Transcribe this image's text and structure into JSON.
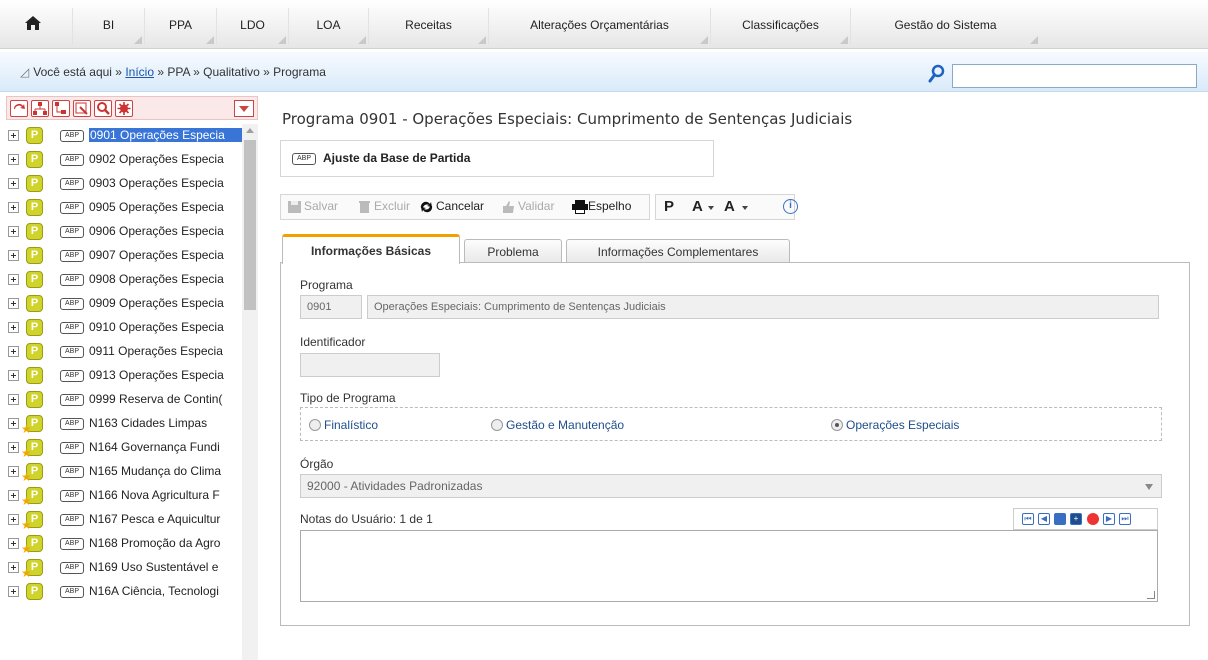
{
  "topmenu": {
    "items": [
      {
        "label": "BI"
      },
      {
        "label": "PPA"
      },
      {
        "label": "LDO"
      },
      {
        "label": "LOA"
      },
      {
        "label": "Receitas"
      },
      {
        "label": "Alterações Orçamentárias"
      },
      {
        "label": "Classificações"
      },
      {
        "label": "Gestão do Sistema"
      }
    ]
  },
  "breadcrumb": {
    "prefix": "Você está aqui » ",
    "home_link": "Início",
    "path": " » PPA » Qualitativo » Programa"
  },
  "search": {
    "value": ""
  },
  "tree": {
    "items": [
      {
        "label": "0901 Operações Especia"
      },
      {
        "label": "0902 Operações Especia"
      },
      {
        "label": "0903 Operações Especia"
      },
      {
        "label": "0905 Operações Especia"
      },
      {
        "label": "0906 Operações Especia"
      },
      {
        "label": "0907 Operações Especia"
      },
      {
        "label": "0908 Operações Especia"
      },
      {
        "label": "0909 Operações Especia"
      },
      {
        "label": "0910 Operações Especia"
      },
      {
        "label": "0911 Operações Especia"
      },
      {
        "label": "0913 Operações Especia"
      },
      {
        "label": "0999 Reserva de Contin("
      },
      {
        "label": "N163 Cidades Limpas"
      },
      {
        "label": "N164 Governança Fundi"
      },
      {
        "label": "N165 Mudança do Clima"
      },
      {
        "label": "N166 Nova Agricultura F"
      },
      {
        "label": "N167 Pesca e Aquicultur"
      },
      {
        "label": "N168 Promoção da Agro"
      },
      {
        "label": "N169 Uso Sustentável e"
      },
      {
        "label": "N16A Ciência, Tecnologi"
      }
    ],
    "badge_letter": "P",
    "abp_label": "ABP"
  },
  "main": {
    "title": "Programa 0901 - Operações Especiais: Cumprimento de Sentenças Judiciais",
    "abp_tag": "ABP",
    "abp_label": "Ajuste da Base de Partida",
    "actions": {
      "save": "Salvar",
      "delete": "Excluir",
      "cancel": "Cancelar",
      "validate": "Validar",
      "mirror": "Espelho"
    },
    "fmt": {
      "p": "P",
      "a1": "A",
      "a2": "A",
      "info": "i"
    },
    "tabs": [
      {
        "label": "Informações Básicas"
      },
      {
        "label": "Problema"
      },
      {
        "label": "Informações Complementares"
      }
    ],
    "form": {
      "programa_label": "Programa",
      "programa_code": "0901",
      "programa_name": "Operações Especiais: Cumprimento de Sentenças Judiciais",
      "identificador_label": "Identificador",
      "identificador_value": "",
      "tipo_label": "Tipo de Programa",
      "tipo_options": [
        "Finalístico",
        "Gestão e Manutenção",
        "Operações Especiais"
      ],
      "tipo_selected": "Operações Especiais",
      "orgao_label": "Órgão",
      "orgao_value": "92000 - Atividades Padronizadas",
      "notas_label": "Notas do Usuário: 1 de 1",
      "notas_value": ""
    }
  },
  "colors": {
    "accent_tab": "#f0a000",
    "selection": "#3875d7",
    "badge": "#cfd32a",
    "link": "#1a56b0"
  }
}
